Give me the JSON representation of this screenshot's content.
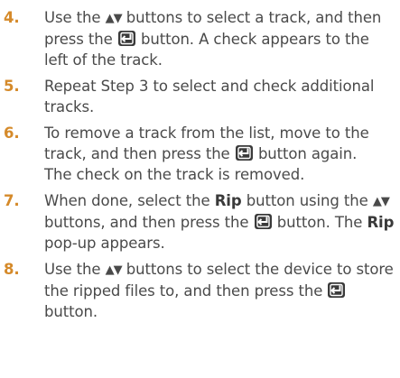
{
  "steps": [
    {
      "number": "4.",
      "text_a": "Use the",
      "arrows": "▲▼",
      "text_b": "buttons to select a track, and then press the",
      "text_c": "button. A check appears to the left of the track."
    },
    {
      "number": "5.",
      "text": "Repeat Step 3 to select and check additional tracks."
    },
    {
      "number": "6.",
      "text_a": "To remove a track from the list, move to the track, and then press the",
      "text_b": "button again.",
      "subtext": "The check on the track is removed."
    },
    {
      "number": "7.",
      "text_a": "When done, select the",
      "bold_a": "Rip",
      "text_b": "button using the",
      "arrows": "▲▼",
      "text_c": "buttons, and then press the",
      "text_d": "button. The",
      "bold_b": "Rip",
      "text_e": "pop-up appears."
    },
    {
      "number": "8.",
      "text_a": "Use the",
      "arrows": "▲▼",
      "text_b": "buttons to select the device to store the ripped files to, and then press the",
      "text_c": "button."
    }
  ],
  "icons": {
    "enter": "enter-button-icon",
    "arrows": "up-down-arrows-icon"
  },
  "colors": {
    "step_number": "#d58a2a",
    "body_text": "#4a4a4a",
    "icon_bg": "#3a3a3a"
  }
}
